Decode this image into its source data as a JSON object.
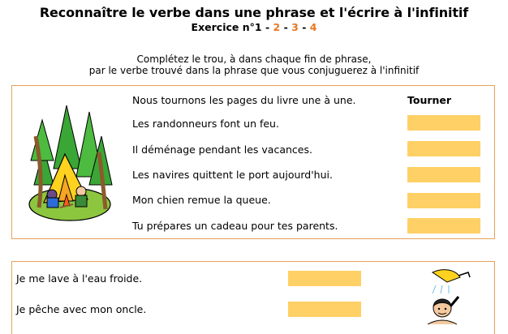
{
  "header": {
    "title": "Reconnaître le verbe dans une phrase et l'écrire à l'infinitif",
    "exercise_label": "Exercice n°1",
    "exercise_links": [
      "2",
      "3",
      "4"
    ],
    "separator": "-"
  },
  "instructions": {
    "line1": "Complétez le trou, à dans chaque fin de phrase,",
    "line2": "par le verbe trouvé dans la phrase que vous conjuguerez à l'infinitif"
  },
  "exercise1": {
    "column_header": "Tourner",
    "sentences": [
      "Nous tournons les pages du livre une à une.",
      "Les randonneurs font un feu.",
      "Il déménage pendant les vacances.",
      "Les navires quittent le port aujourd'hui.",
      "Mon chien remue la queue.",
      "Tu prépares un cadeau pour tes parents."
    ],
    "answers": [
      "",
      "",
      "",
      "",
      ""
    ],
    "illustration": "camping-tent-campfire-illustration"
  },
  "exercise2": {
    "sentences": [
      "Je me lave à l'eau froide.",
      "Je pêche avec mon oncle."
    ],
    "answers": [
      "",
      ""
    ],
    "illustration": "shower-boy-illustration"
  },
  "colors": {
    "answer_fill": "#ffd066",
    "border": "#e8a25a",
    "link": "#e87722"
  }
}
